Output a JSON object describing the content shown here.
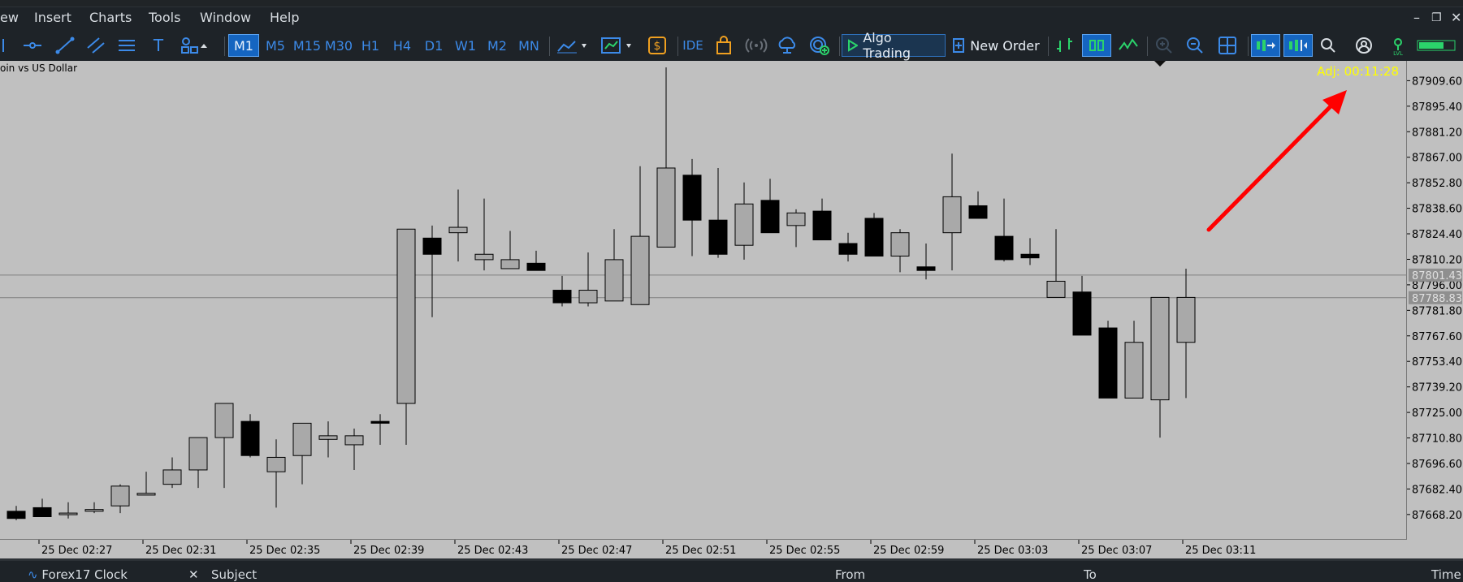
{
  "menu": {
    "view": "ew",
    "insert": "Insert",
    "charts": "Charts",
    "tools": "Tools",
    "window": "Window",
    "help": "Help"
  },
  "toolbar": {
    "timeframes": [
      "M1",
      "M5",
      "M15",
      "M30",
      "H1",
      "H4",
      "D1",
      "W1",
      "M2",
      "MN"
    ],
    "active_timeframe": "M1",
    "ide_label": "IDE",
    "algo_trading_label": "Algo Trading",
    "new_order_label": "New Order"
  },
  "chart": {
    "symbol_label": "oin vs US Dollar",
    "timer_label": "Adj: 00:11:28",
    "price_labels": [
      "87909.60",
      "87895.40",
      "87881.20",
      "87867.00",
      "87852.80",
      "87838.60",
      "87824.40",
      "87810.20",
      "87796.00",
      "87781.80",
      "87767.60",
      "87753.40",
      "87739.20",
      "87725.00",
      "87710.80",
      "87696.60",
      "87682.40",
      "87668.20"
    ],
    "bid_label": "87801.43",
    "ask_label": "87788.83",
    "time_labels": [
      "25 Dec 02:27",
      "25 Dec 02:31",
      "25 Dec 02:35",
      "25 Dec 02:39",
      "25 Dec 02:43",
      "25 Dec 02:47",
      "25 Dec 02:51",
      "25 Dec 02:55",
      "25 Dec 02:59",
      "25 Dec 03:03",
      "25 Dec 03:07",
      "25 Dec 03:11"
    ],
    "colors": {
      "background": "#c0c0c0",
      "bull": "#a9a9a9",
      "bear": "#000000",
      "timer": "#ffff00",
      "arrow": "#ff0000"
    }
  },
  "chart_data": {
    "type": "candlestick",
    "x": [
      "02:26",
      "02:27",
      "02:28",
      "02:29",
      "02:30",
      "02:31",
      "02:32",
      "02:33",
      "02:34",
      "02:35",
      "02:36",
      "02:37",
      "02:38",
      "02:39",
      "02:40",
      "02:41",
      "02:42",
      "02:43",
      "02:44",
      "02:45",
      "02:46",
      "02:47",
      "02:48",
      "02:49",
      "02:50",
      "02:51",
      "02:52",
      "02:53",
      "02:54",
      "02:55",
      "02:56",
      "02:57",
      "02:58",
      "02:59",
      "03:00",
      "03:01",
      "03:02",
      "03:03",
      "03:04",
      "03:05",
      "03:06",
      "03:07",
      "03:08",
      "03:09",
      "03:10",
      "03:11"
    ],
    "open": [
      87670,
      87672,
      87669,
      87670,
      87673,
      87679,
      87685,
      87693,
      87711,
      87720,
      87692,
      87701,
      87710,
      87707,
      87720,
      87730,
      87822,
      87825,
      87810,
      87805,
      87808,
      87793,
      87786,
      87787,
      87785,
      87817,
      87857,
      87832,
      87818,
      87843,
      87829,
      87837,
      87819,
      87833,
      87812,
      87806,
      87825,
      87840,
      87823,
      87813,
      87789,
      87792,
      87772,
      87733,
      87732,
      87764
    ],
    "high": [
      87673,
      87677,
      87675,
      87675,
      87685,
      87692,
      87700,
      87703,
      87722,
      87724,
      87710,
      87710,
      87720,
      87716,
      87724,
      87733,
      87829,
      87849,
      87844,
      87826,
      87815,
      87801,
      87814,
      87827,
      87862,
      87917,
      87866,
      87861,
      87853,
      87855,
      87838,
      87844,
      87825,
      87836,
      87827,
      87819,
      87869,
      87848,
      87844,
      87822,
      87827,
      87801,
      87776,
      87776,
      87771,
      87805
    ],
    "low": [
      87665,
      87668,
      87666,
      87669,
      87669,
      87679,
      87683,
      87683,
      87683,
      87700,
      87672,
      87685,
      87700,
      87693,
      87707,
      87707,
      87778,
      87809,
      87804,
      87805,
      87806,
      87784,
      87784,
      87787,
      87785,
      87827,
      87812,
      87811,
      87810,
      87825,
      87817,
      87824,
      87809,
      87816,
      87803,
      87799,
      87804,
      87833,
      87809,
      87807,
      87792,
      87769,
      87761,
      87734,
      87711,
      87733
    ],
    "close": [
      87666,
      87667,
      87669,
      87671,
      87684,
      87680,
      87693,
      87711,
      87730,
      87701,
      87700,
      87719,
      87712,
      87712,
      87719,
      87827,
      87813,
      87828,
      87813,
      87810,
      87804,
      87786,
      87793,
      87810,
      87823,
      87861,
      87832,
      87813,
      87841,
      87825,
      87836,
      87821,
      87813,
      87812,
      87825,
      87804,
      87845,
      87833,
      87810,
      87811,
      87798,
      87768,
      87733,
      87764,
      87789,
      87789
    ],
    "ylim": [
      87660,
      87917
    ]
  }
}
